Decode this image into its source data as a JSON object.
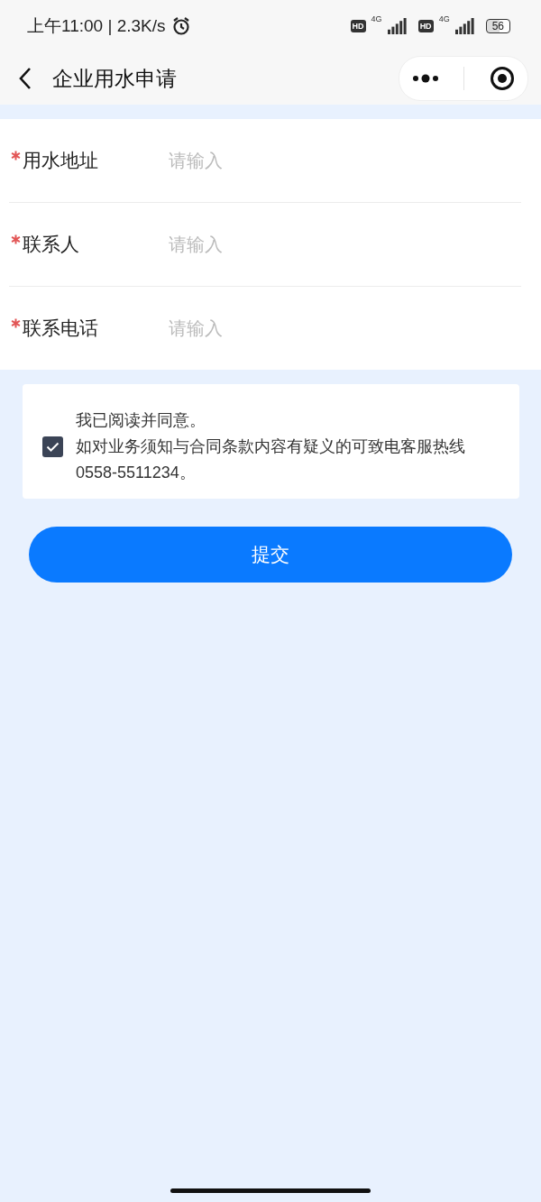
{
  "status_bar": {
    "time": "上午11:00 | 2.3K/s",
    "sims": [
      {
        "badge": "HD",
        "network": "4G"
      },
      {
        "badge": "HD",
        "network": "4G"
      }
    ],
    "battery": "56"
  },
  "nav_bar": {
    "title": "企业用水申请"
  },
  "form": {
    "fields": [
      {
        "label": "用水地址",
        "required": true,
        "placeholder": "请输入"
      },
      {
        "label": "联系人",
        "required": true,
        "placeholder": "请输入"
      },
      {
        "label": "联系电话",
        "required": true,
        "placeholder": "请输入"
      }
    ]
  },
  "agreement": {
    "checked": true,
    "lines": [
      "我已阅读并同意。",
      "如对业务须知与合同条款内容有疑义的可致电客服热线 0558-5511234。"
    ]
  },
  "submit_button": "提交"
}
